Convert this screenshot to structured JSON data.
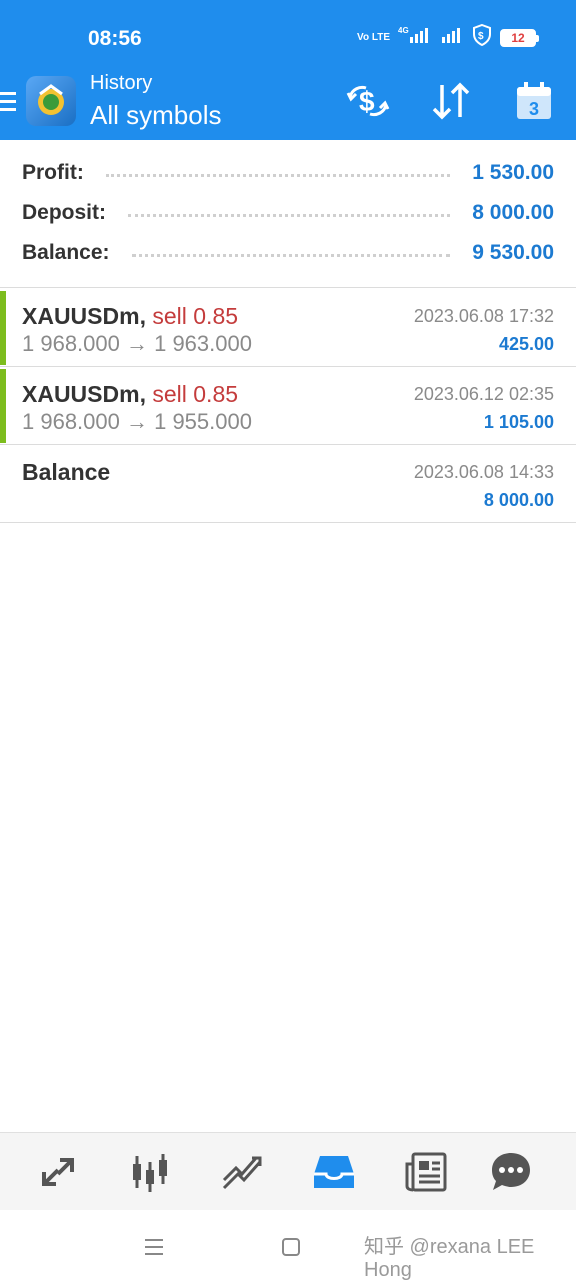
{
  "status": {
    "time": "08:56",
    "volte": "Vo LTE",
    "net": "4G",
    "battery": "12"
  },
  "header": {
    "subtitle": "History",
    "title": "All symbols",
    "calendar_day": "3"
  },
  "icons": {
    "menu": "hamburger-icon",
    "app": "metatrader-logo-icon",
    "currency": "currency-exchange-icon",
    "sort": "sort-arrows-icon",
    "calendar": "calendar-icon"
  },
  "summary": [
    {
      "label": "Profit:",
      "value": "1 530.00"
    },
    {
      "label": "Deposit:",
      "value": "8 000.00"
    },
    {
      "label": "Balance:",
      "value": "9 530.00"
    }
  ],
  "deals": [
    {
      "symbol": "XAUUSDm,",
      "side": "sell 0.85",
      "prices": "1 968.000 → 1 963.000",
      "date": "2023.06.08 17:32",
      "amount": "425.00"
    },
    {
      "symbol": "XAUUSDm,",
      "side": "sell 0.85",
      "prices": "1 968.000 → 1 955.000",
      "date": "2023.06.12 02:35",
      "amount": "1 105.00"
    }
  ],
  "balance_op": {
    "label": "Balance",
    "date": "2023.06.08 14:33",
    "amount": "8 000.00"
  },
  "tabs": [
    "trade-arrows-icon",
    "candles-icon",
    "chart-line-icon",
    "history-inbox-icon",
    "news-icon",
    "chat-icon"
  ],
  "watermark": "知乎 @rexana LEE Hong",
  "colors": {
    "primary": "#1f8ded",
    "profit": "#1c7ad1",
    "sell": "#c43c3c",
    "buy_bar": "#7dbd1e"
  }
}
